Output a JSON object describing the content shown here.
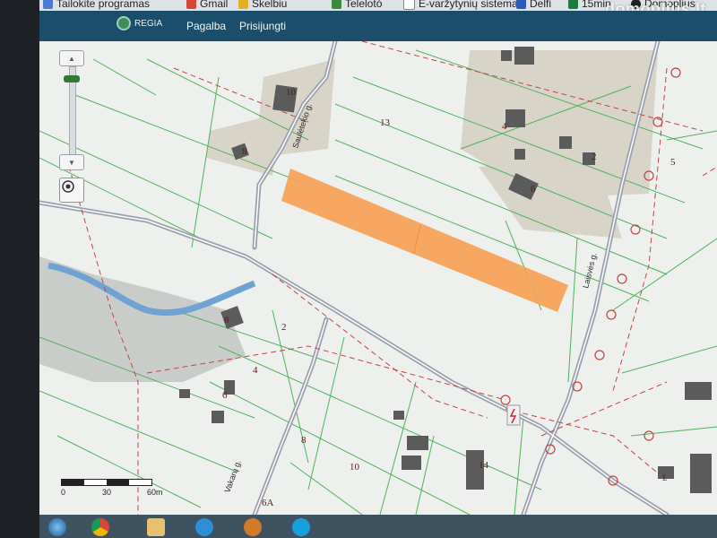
{
  "bookmarks": [
    {
      "label": "Tailokite programas",
      "color": "#4a7bd1"
    },
    {
      "label": "Gmail",
      "color": "#d44638"
    },
    {
      "label": "Skelbiu",
      "color": "#e3b02a"
    },
    {
      "label": "Telelotó",
      "color": "#3a8c3a"
    },
    {
      "label": "E-varžytynių sistema",
      "color": "#ffffff"
    },
    {
      "label": "Delfi",
      "color": "#2a5bb5"
    },
    {
      "label": "15min",
      "color": "#1b7b3a"
    },
    {
      "label": "Domoplius",
      "color": "#222222"
    }
  ],
  "watermark": "domoplius.lt",
  "app": {
    "logo_text": "REGIA",
    "nav": [
      "Pagalba",
      "Prisijungti"
    ]
  },
  "map": {
    "parcels": [
      "10",
      "8",
      "13",
      "4",
      "2",
      "6",
      "5",
      "8",
      "2",
      "4",
      "6",
      "8",
      "10",
      "14",
      "1",
      "6A"
    ],
    "streets": [
      "Saulėtekio g.",
      "Laisvės g.",
      "Vakarų g."
    ],
    "highlight_color": "#f5a35a",
    "scale_labels": [
      "0",
      "30",
      "60m"
    ],
    "zoom_level": 0.11
  },
  "taskbar": {
    "items": [
      "start-button",
      "chrome-icon",
      "file-explorer-icon",
      "internet-explorer-icon",
      "gear-icon",
      "skype-icon"
    ]
  }
}
